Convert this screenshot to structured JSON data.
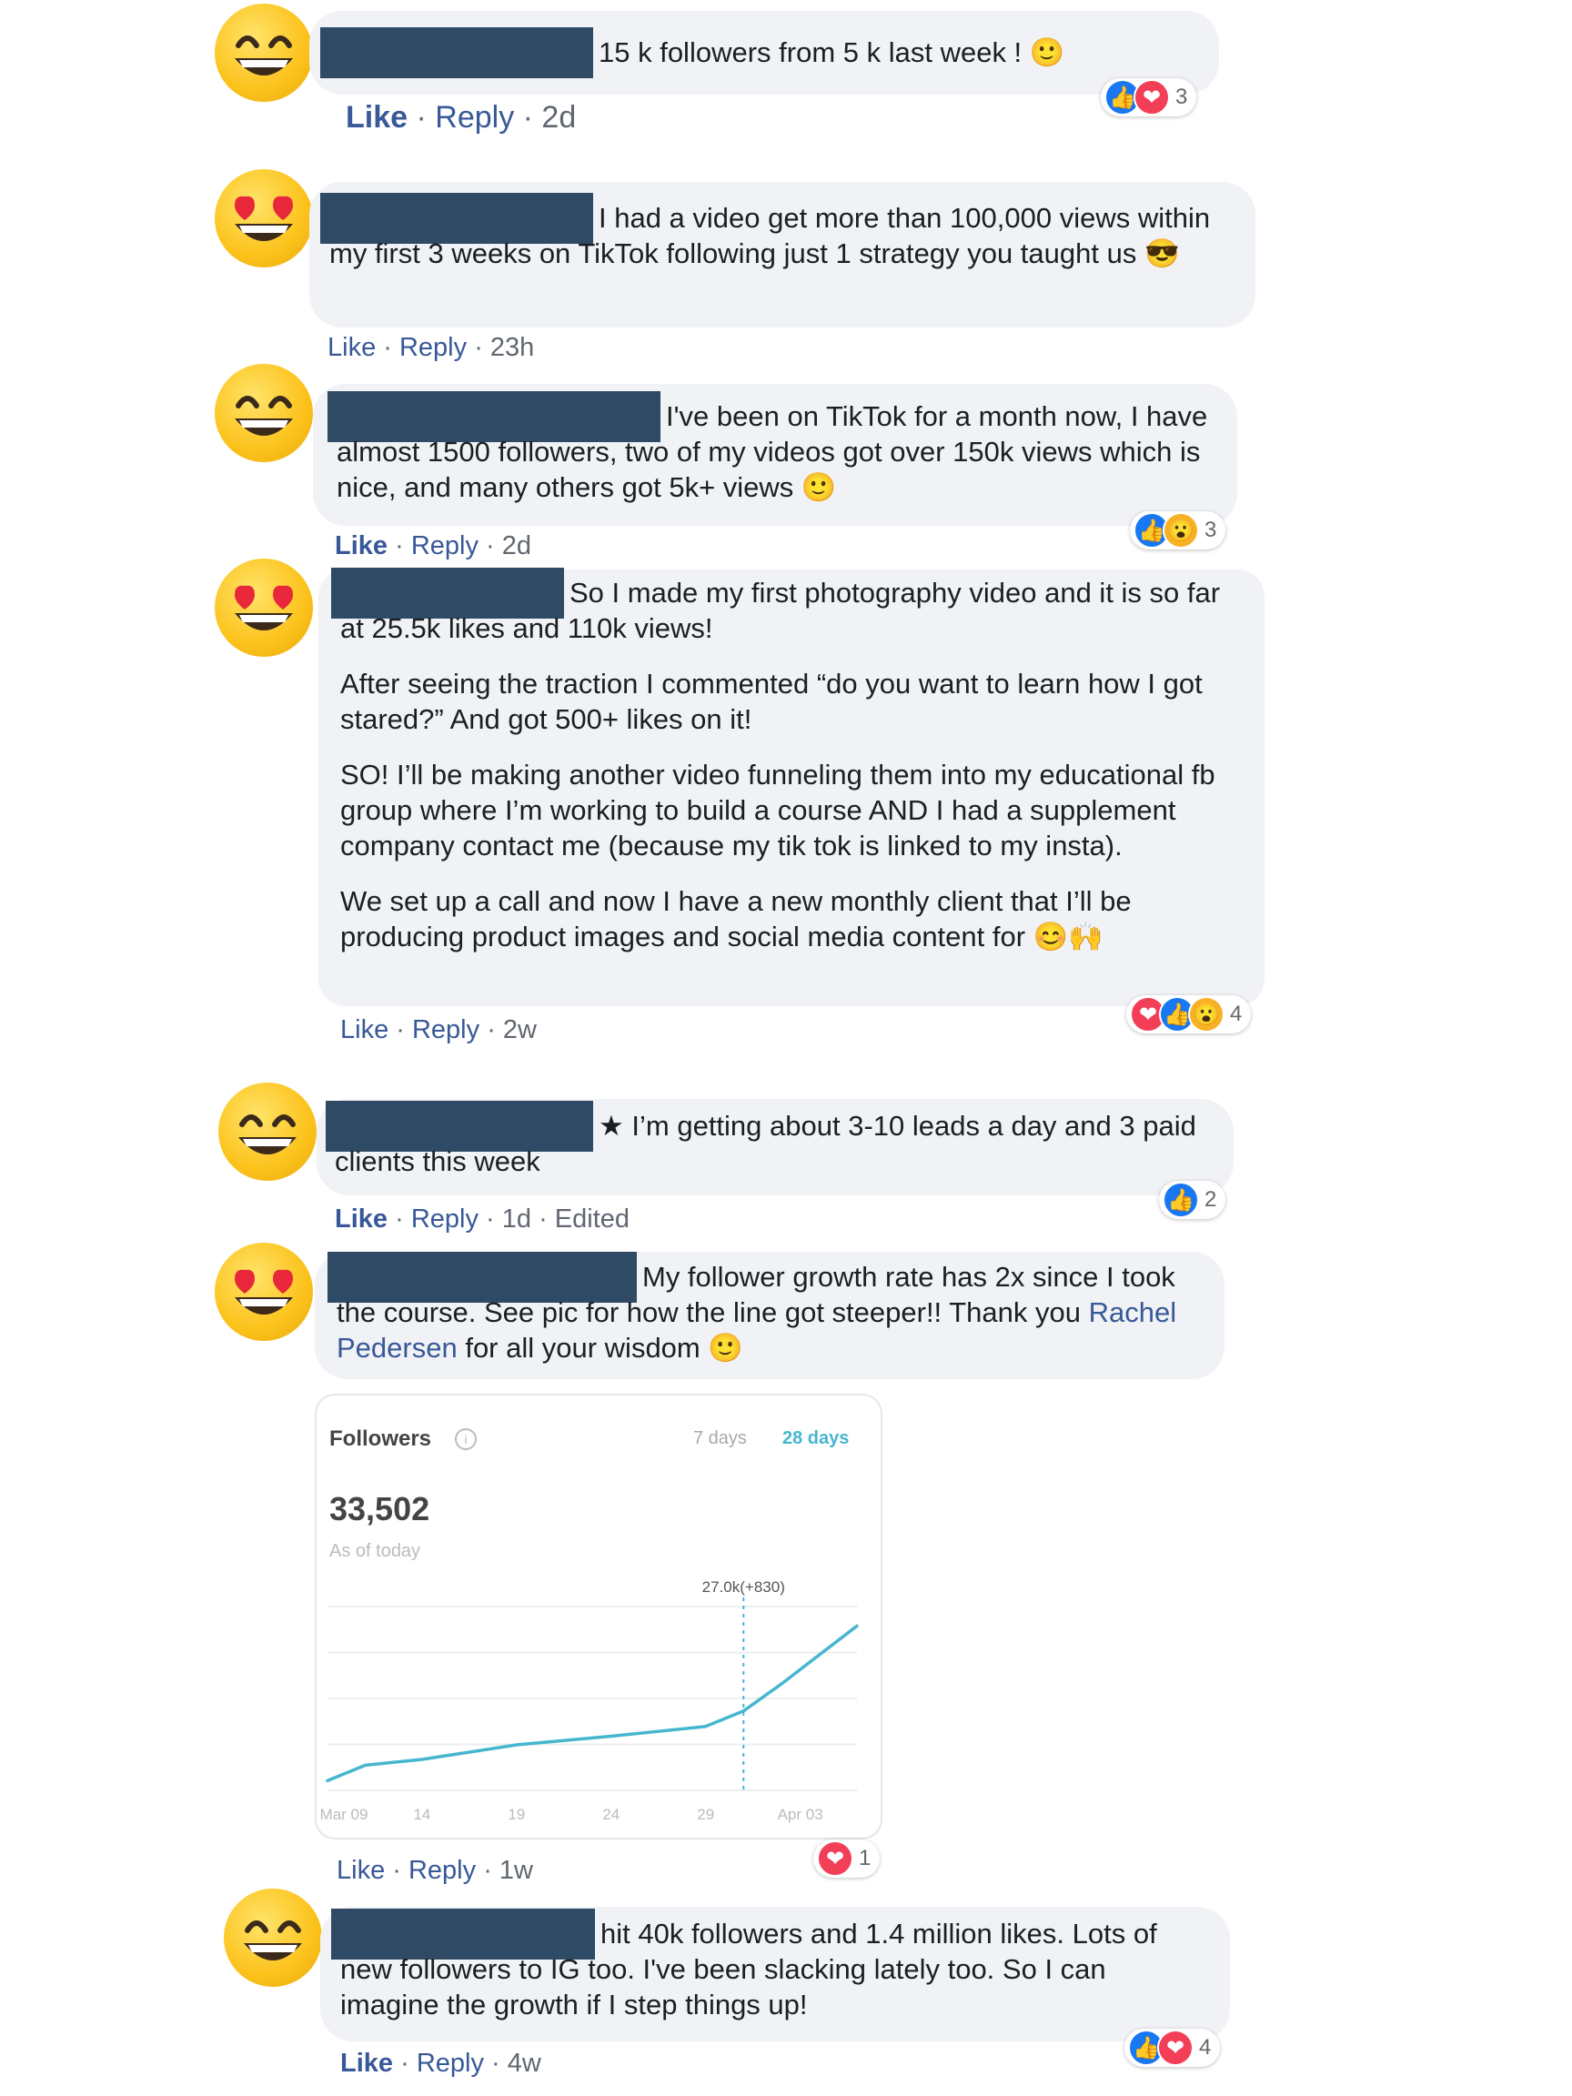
{
  "comments": [
    {
      "text": [
        "15 k followers from 5 k last week ! 🙂"
      ],
      "meta": {
        "like": "Like",
        "reply": "Reply",
        "time": "2d",
        "edited": ""
      },
      "reactions": {
        "icons": [
          "like-icon",
          "love-icon"
        ],
        "count": "3"
      }
    },
    {
      "text": [
        "I had a video get more than 100,000 views within my first 3 weeks on TikTok following just 1 strategy you taught us 😎"
      ],
      "meta": {
        "like": "Like",
        "reply": "Reply",
        "time": "23h",
        "edited": ""
      }
    },
    {
      "text": [
        "I've been on TikTok for a month now, I have almost 1500 followers, two of my videos got over 150k views which is nice, and many others got 5k+ views 🙂"
      ],
      "meta": {
        "like": "Like",
        "reply": "Reply",
        "time": "2d",
        "edited": ""
      },
      "reactions": {
        "icons": [
          "like-icon",
          "wow-icon"
        ],
        "count": "3"
      }
    },
    {
      "text": [
        "So I made my first photography video and it is so far at 25.5k likes and 110k views!",
        "After seeing the traction I commented “do you want to learn how I got stared?” And got 500+ likes on it!",
        "SO! I’ll be making another video funneling them into my educational fb group where I’m working to build a course AND I had a supplement company contact me (because my tik tok is linked to my insta).",
        "We set up a call and now I have a new monthly client that I’ll be producing product images and social media content for 😊🙌"
      ],
      "meta": {
        "like": "Like",
        "reply": "Reply",
        "time": "2w",
        "edited": ""
      },
      "reactions": {
        "icons": [
          "love-icon",
          "like-icon",
          "wow-icon"
        ],
        "count": "4"
      }
    },
    {
      "text": [
        "★ I’m getting about 3-10 leads a day and 3 paid clients this week"
      ],
      "meta": {
        "like": "Like",
        "reply": "Reply",
        "time": "1d",
        "edited": "Edited"
      },
      "reactions": {
        "icons": [
          "like-icon"
        ],
        "count": "2"
      }
    },
    {
      "text_before": "My follower growth rate has 2x since I took the course. See pic for how the line got steeper!! Thank you ",
      "mention": "Rachel Pedersen",
      "text_after": " for all your wisdom 🙂",
      "meta": {
        "like": "Like",
        "reply": "Reply",
        "time": "1w",
        "edited": ""
      },
      "reactions": {
        "icons": [
          "love-icon"
        ],
        "count": "1"
      }
    },
    {
      "text": [
        "hit 40k followers and 1.4 million likes. Lots of new followers to IG too. I've been slacking lately too. So I can imagine the growth if I step things up!"
      ],
      "meta": {
        "like": "Like",
        "reply": "Reply",
        "time": "4w",
        "edited": ""
      },
      "reactions": {
        "icons": [
          "like-icon",
          "love-icon"
        ],
        "count": "4"
      }
    }
  ],
  "chart_card": {
    "title": "Followers",
    "tab_7": "7 days",
    "tab_28": "28 days",
    "value": "33,502",
    "subtitle": "As of today",
    "tooltip": "27.0k(+830)"
  },
  "chart_data": {
    "type": "line",
    "title": "Followers",
    "x_tick_labels": [
      "Mar 09",
      "14",
      "19",
      "24",
      "29",
      "Apr 03"
    ],
    "x": [
      0,
      2,
      5,
      10,
      15,
      20,
      22,
      24,
      26,
      28
    ],
    "y": [
      16000,
      17600,
      18200,
      19700,
      20600,
      21600,
      23200,
      26000,
      29000,
      32000
    ],
    "ylim": [
      15000,
      34000
    ],
    "annotation": {
      "x": 22,
      "label": "27.0k(+830)"
    },
    "grid": true,
    "color": "#46b6cf"
  },
  "colors": {
    "bubble": "#f0f2f5",
    "link": "#385898",
    "redaction": "#2e4a64",
    "like": "#1877f2",
    "love": "#f33e58"
  }
}
